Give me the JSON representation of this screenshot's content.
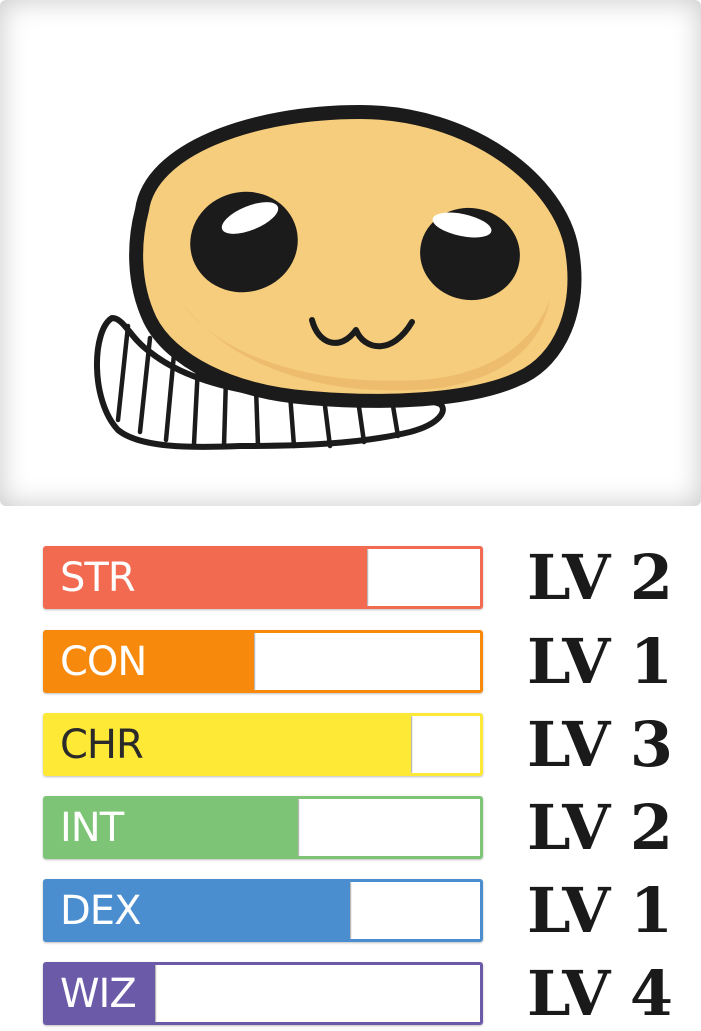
{
  "stats": [
    {
      "label": "STR",
      "level": "LV 2",
      "fill_percent": 74,
      "color": "#f26b50",
      "text_color": "#ffffff"
    },
    {
      "label": "CON",
      "level": "LV 1",
      "fill_percent": 48,
      "color": "#f78a0c",
      "text_color": "#ffffff"
    },
    {
      "label": "CHR",
      "level": "LV 3",
      "fill_percent": 84,
      "color": "#fde936",
      "text_color": "#2a2a2a"
    },
    {
      "label": "INT",
      "level": "LV 2",
      "fill_percent": 58,
      "color": "#7ec476",
      "text_color": "#ffffff"
    },
    {
      "label": "DEX",
      "level": "LV 1",
      "fill_percent": 70,
      "color": "#4a8ed0",
      "text_color": "#ffffff"
    },
    {
      "label": "WIZ",
      "level": "LV 4",
      "fill_percent": 25,
      "color": "#6b5aa8",
      "text_color": "#ffffff"
    }
  ],
  "character": {
    "icon": "blob-creature-icon",
    "skin_color": "#f6cd7c",
    "outline_color": "#1b1b1b"
  }
}
